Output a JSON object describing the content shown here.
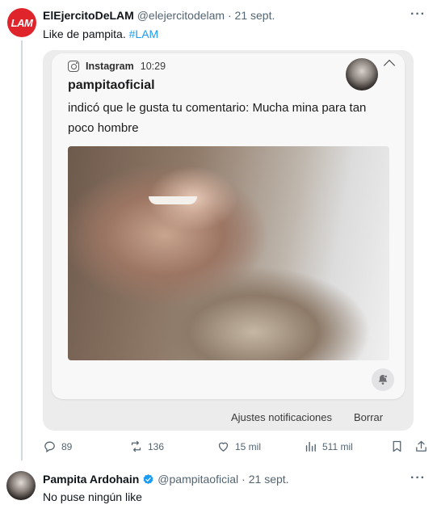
{
  "tweet1": {
    "avatar_text": "LAM",
    "display_name": "ElEjercitoDeLAM",
    "handle": "@elejercitodelam",
    "separator": "·",
    "time": "21 sept.",
    "text": "Like de pampita.",
    "hashtag": "#LAM",
    "embedded_notification": {
      "app_name": "Instagram",
      "time": "10:29",
      "username": "pampitaoficial",
      "message": "indicó que le gusta tu comentario: Mucha mina para tan poco hombre",
      "actions": [
        "Ajustes notificaciones",
        "Borrar"
      ]
    },
    "metrics": {
      "replies": "89",
      "retweets": "136",
      "likes": "15 mil",
      "views": "511 mil"
    }
  },
  "tweet2": {
    "display_name": "Pampita Ardohain",
    "handle": "@pampitaoficial",
    "separator": "·",
    "time": "21 sept.",
    "text": "No puse ningún like"
  },
  "colors": {
    "link": "#1d9bf0",
    "secondary_text": "#536471",
    "brand_avatar": "#e0242b"
  }
}
